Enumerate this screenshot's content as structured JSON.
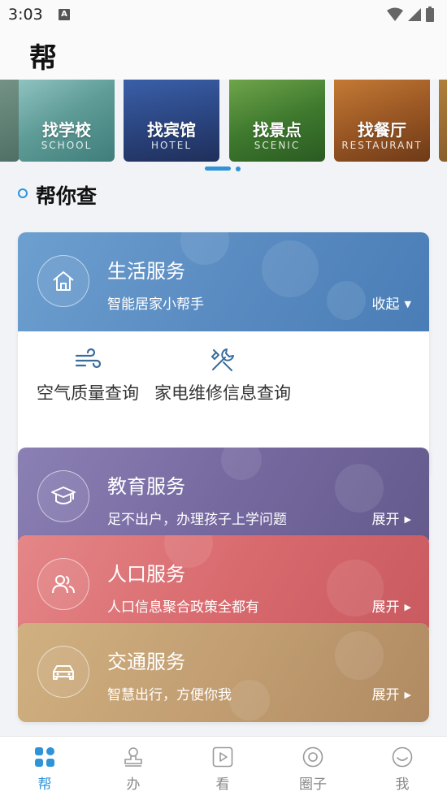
{
  "status_bar": {
    "time": "3:03",
    "notif_letter": "A"
  },
  "header": {
    "title": "帮"
  },
  "carousel": {
    "tiles": [
      {
        "title": "找学校",
        "subtitle": "SCHOOL"
      },
      {
        "title": "找宾馆",
        "subtitle": "HOTEL"
      },
      {
        "title": "找景点",
        "subtitle": "SCENIC"
      },
      {
        "title": "找餐厅",
        "subtitle": "RESTAURANT"
      }
    ]
  },
  "section": {
    "title": "帮你查"
  },
  "cards": [
    {
      "title": "生活服务",
      "desc": "智能居家小帮手",
      "toggle": "收起",
      "icon": "home-icon",
      "color": "#5b8fc4",
      "items": [
        {
          "label": "空气质量查询",
          "icon": "wind-icon"
        },
        {
          "label": "家电维修信息查询",
          "icon": "tools-icon"
        }
      ]
    },
    {
      "title": "教育服务",
      "desc": "足不出户，办理孩子上学问题",
      "toggle": "展开",
      "icon": "graduation-cap-icon",
      "color": "#7b6fa4"
    },
    {
      "title": "人口服务",
      "desc": "人口信息聚合政策全都有",
      "toggle": "展开",
      "icon": "people-icon",
      "color": "#d96b6f"
    },
    {
      "title": "交通服务",
      "desc": "智慧出行，方便你我",
      "toggle": "展开",
      "icon": "car-icon",
      "color": "#c29e72"
    }
  ],
  "bottom_nav": [
    {
      "label": "帮",
      "icon": "grid-icon",
      "active": true
    },
    {
      "label": "办",
      "icon": "stamp-icon",
      "active": false
    },
    {
      "label": "看",
      "icon": "play-icon",
      "active": false
    },
    {
      "label": "圈子",
      "icon": "circle-icon",
      "active": false
    },
    {
      "label": "我",
      "icon": "smile-icon",
      "active": false
    }
  ],
  "colors": {
    "accent": "#2f93d8",
    "nav_inactive": "#888888"
  }
}
